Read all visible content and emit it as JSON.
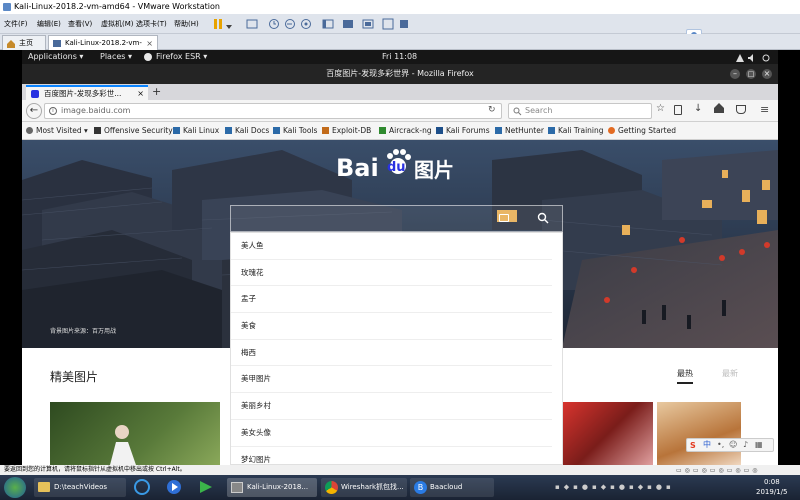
{
  "vmware": {
    "title": "Kali-Linux-2018.2-vm-amd64 - VMware Workstation",
    "menu": [
      "文件(F)",
      "编辑(E)",
      "查看(V)",
      "虚拟机(M)",
      "选项卡(T)",
      "帮助(H)"
    ],
    "tabs": [
      {
        "label": "主页"
      },
      {
        "label": "Kali-Linux-2018.2-vm-am..."
      }
    ],
    "status_text": "要返回到您的计算机，请将鼠标指针从虚拟机中移出或按 Ctrl+Alt。"
  },
  "kali_panel": {
    "applications": "Applications ▾",
    "places": "Places ▾",
    "firefox": "Firefox ESR ▾",
    "clock": "Fri 11:08"
  },
  "firefox": {
    "window_title": "百度图片-发现多彩世界 - Mozilla Firefox",
    "tab_label": "百度图片-发现多彩世...",
    "url": "image.baidu.com",
    "search_placeholder": "Search",
    "bookmarks": [
      {
        "label": "Most Visited ▾",
        "icon": "gear-icon"
      },
      {
        "label": "Offensive Security",
        "icon": "offsec-icon"
      },
      {
        "label": "Kali Linux",
        "icon": "kali-dragon-icon"
      },
      {
        "label": "Kali Docs",
        "icon": "kali-dragon-icon"
      },
      {
        "label": "Kali Tools",
        "icon": "kali-dragon-icon"
      },
      {
        "label": "Exploit-DB",
        "icon": "exploit-db-icon"
      },
      {
        "label": "Aircrack-ng",
        "icon": "aircrack-icon"
      },
      {
        "label": "Kali Forums",
        "icon": "kali-forums-icon"
      },
      {
        "label": "NetHunter",
        "icon": "kali-dragon-icon"
      },
      {
        "label": "Kali Training",
        "icon": "kali-dragon-icon"
      },
      {
        "label": "Getting Started",
        "icon": "firefox-icon"
      }
    ]
  },
  "baidu": {
    "logo_bai": "Bai",
    "logo_du": "du",
    "logo_images": "图片",
    "hero_caption": "背景图片来源：百万用战",
    "suggestions": [
      "美人鱼",
      "玫瑰花",
      "盂子",
      "美食",
      "梅西",
      "美甲图片",
      "美丽乡村",
      "美女头像",
      "梦幻图片"
    ],
    "section_title": "精美图片",
    "tab_hot": "最热",
    "tab_new": "最新"
  },
  "taskbar": {
    "items": [
      {
        "label": "D:\\teachVideos"
      },
      {
        "label": "Kali-Linux-2018..."
      },
      {
        "label": "Wireshark抓包找..."
      },
      {
        "label": "Baacloud"
      }
    ],
    "time": "0:08",
    "date": "2019/1/5",
    "ime_label": "中"
  },
  "colors": {
    "baidu_blue": "#2932e1",
    "baidu_red": "#de3f27",
    "kali_panel": "#161616",
    "taskbar": "#1f2a3d"
  }
}
